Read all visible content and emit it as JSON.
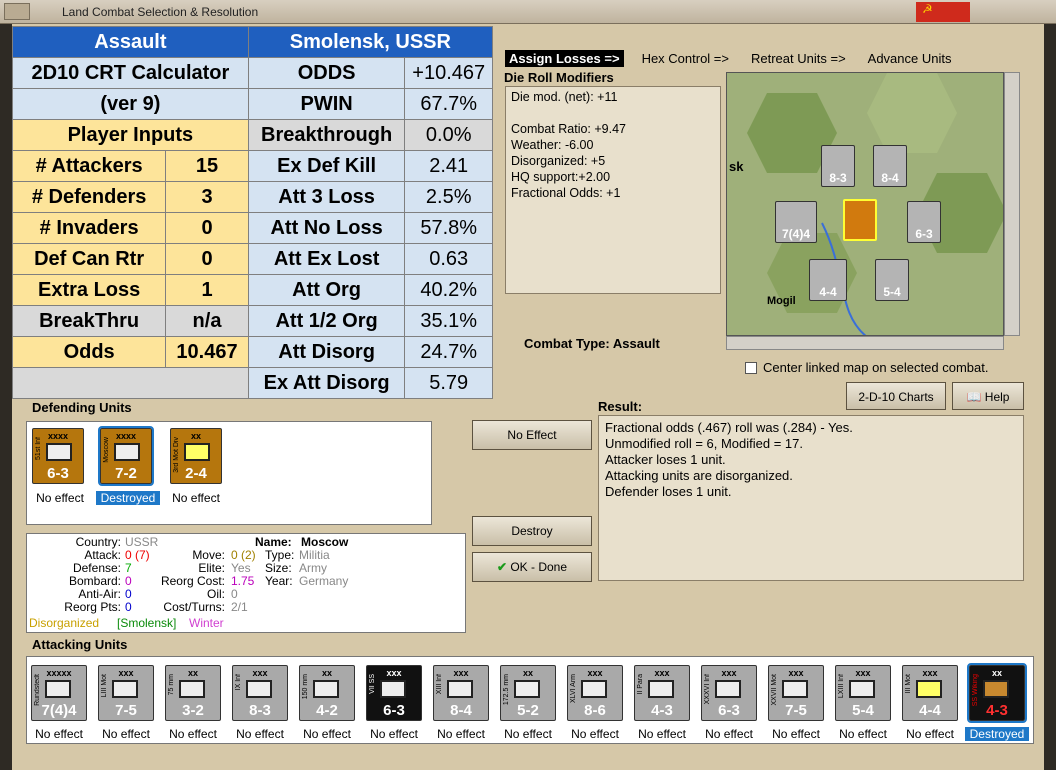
{
  "window": {
    "title": "Land Combat Selection & Resolution"
  },
  "tabs": [
    "Assign Losses =>",
    "Hex Control =>",
    "Retreat Units =>",
    "Advance Units"
  ],
  "die_roll": {
    "title": "Die Roll Modifiers",
    "lines": [
      "Die mod. (net): +11",
      "",
      "Combat Ratio: +9.47",
      "Weather: -6.00",
      "Disorganized: +5",
      "HQ support:+2.00",
      "Fractional Odds: +1"
    ]
  },
  "combat_type": {
    "label": "Combat Type:",
    "value": "Assault"
  },
  "center_map": "Center linked map on selected combat.",
  "buttons": {
    "charts": "2-D-10 Charts",
    "help": "Help",
    "no_effect": "No Effect",
    "destroy": "Destroy",
    "ok": "OK - Done"
  },
  "result": {
    "title": "Result:",
    "lines": [
      "Fractional odds (.467) roll was (.284)  - Yes.",
      "Unmodified roll = 6, Modified = 17.",
      "Attacker loses 1 unit.",
      "Attacking units are disorganized.",
      "Defender loses 1 unit."
    ]
  },
  "calculator": {
    "title_left": "Assault",
    "title_right": "Smolensk, USSR",
    "name1": "2D10 CRT Calculator",
    "name2": "(ver 9)",
    "inputs_title": "Player Inputs",
    "inputs": [
      {
        "label": "# Attackers",
        "value": "15"
      },
      {
        "label": "# Defenders",
        "value": "3"
      },
      {
        "label": "# Invaders",
        "value": "0"
      },
      {
        "label": "Def Can Rtr",
        "value": "0"
      },
      {
        "label": "Extra Loss",
        "value": "1"
      },
      {
        "label": "BreakThru",
        "value": "n/a"
      },
      {
        "label": "Odds",
        "value": "10.467"
      }
    ],
    "results": [
      {
        "label": "ODDS",
        "value": "+10.467"
      },
      {
        "label": "PWIN",
        "value": "67.7%"
      },
      {
        "label": "Breakthrough",
        "value": "0.0%"
      },
      {
        "label": "Ex Def Kill",
        "value": "2.41"
      },
      {
        "label": "Att 3 Loss",
        "value": "2.5%"
      },
      {
        "label": "Att No Loss",
        "value": "57.8%"
      },
      {
        "label": "Att Ex Lost",
        "value": "0.63"
      },
      {
        "label": "Att Org",
        "value": "40.2%"
      },
      {
        "label": "Att 1/2 Org",
        "value": "35.1%"
      },
      {
        "label": "Att Disorg",
        "value": "24.7%"
      },
      {
        "label": "Ex Att Disorg",
        "value": "5.79"
      }
    ]
  },
  "defending": {
    "title": "Defending Units",
    "units": [
      {
        "size": "xxxx",
        "name": "51st Inf",
        "stats": "6-3",
        "status": "No effect"
      },
      {
        "size": "xxxx",
        "name": "Moscow",
        "stats": "7-2",
        "status": "Destroyed"
      },
      {
        "size": "xx",
        "name": "3rd Mot Div",
        "stats": "2-4",
        "status": "No effect"
      }
    ]
  },
  "info": {
    "country_label": "Country:",
    "country": "USSR",
    "attack_label": "Attack:",
    "attack": "0",
    "attack_paren": "(7)",
    "defense_label": "Defense:",
    "defense": "7",
    "bombard_label": "Bombard:",
    "bombard": "0",
    "antiair_label": "Anti-Air:",
    "antiair": "0",
    "reorg_label": "Reorg Pts:",
    "reorg": "0",
    "name_label": "Name:",
    "name": "Moscow",
    "move_label": "Move:",
    "move": "0 (2)",
    "elite_label": "Elite:",
    "elite": "Yes",
    "reorgcost_label": "Reorg Cost:",
    "reorgcost": "1.75",
    "oil_label": "Oil:",
    "oil": "0",
    "costturns_label": "Cost/Turns:",
    "costturns": "2/1",
    "type_label": "Type:",
    "type": "Militia",
    "size_label": "Size:",
    "size": "Army",
    "year_label": "Year:",
    "year": "Germany",
    "s1": "Disorganized",
    "s2": "[Smolensk]",
    "s3": "Winter"
  },
  "attacking": {
    "title": "Attacking Units",
    "units": [
      {
        "size": "xxxxx",
        "name": "Rundstedt",
        "stats": "7(4)4",
        "status": "No effect"
      },
      {
        "size": "xxx",
        "name": "LIII Mot",
        "stats": "7-5",
        "status": "No effect"
      },
      {
        "size": "xx",
        "name": "75 mm",
        "stats": "3-2",
        "status": "No effect"
      },
      {
        "size": "xxx",
        "name": "IX Inf",
        "stats": "8-3",
        "status": "No effect"
      },
      {
        "size": "xx",
        "name": "150 mm",
        "stats": "4-2",
        "status": "No effect"
      },
      {
        "size": "xxx",
        "name": "VII SS",
        "stats": "6-3",
        "status": "No effect"
      },
      {
        "size": "xxx",
        "name": "XIII Inf",
        "stats": "8-4",
        "status": "No effect"
      },
      {
        "size": "xx",
        "name": "172.5 mm",
        "stats": "5-2",
        "status": "No effect"
      },
      {
        "size": "xxx",
        "name": "XLVI Arm",
        "stats": "8-6",
        "status": "No effect"
      },
      {
        "size": "xxx",
        "name": "II Para",
        "stats": "4-3",
        "status": "No effect"
      },
      {
        "size": "xxx",
        "name": "XXXVI Inf",
        "stats": "6-3",
        "status": "No effect"
      },
      {
        "size": "xxx",
        "name": "XXVII Mot",
        "stats": "7-5",
        "status": "No effect"
      },
      {
        "size": "xxx",
        "name": "LXIII Inf",
        "stats": "5-4",
        "status": "No effect"
      },
      {
        "size": "xxx",
        "name": "III Mot",
        "stats": "4-4",
        "status": "No effect"
      },
      {
        "size": "xx",
        "name": "SS Wiking",
        "stats": "4-3",
        "status": "Destroyed"
      }
    ]
  },
  "map": {
    "labels": [
      "sk",
      "Mogil"
    ],
    "units": [
      "8-3",
      "8-4",
      "7(4)4",
      "6-3",
      "4-4",
      "5-4"
    ]
  },
  "colors": {
    "calc_header": "#1f5fbf",
    "calc_input": "#fde49a",
    "calc_result": "#d5e3f2",
    "soviet_unit": "#b5760d",
    "german_unit": "#a9a9a9",
    "destroyed_bg": "#1e78c8"
  }
}
